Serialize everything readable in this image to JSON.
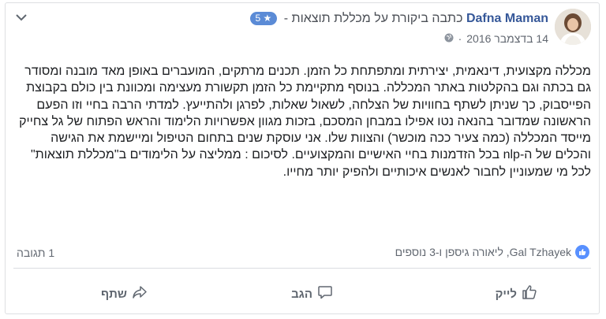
{
  "post": {
    "author": "Dafna Maman",
    "action_text": "כתבה ביקורת על מכללת תוצאות -",
    "rating_badge": "5 ★",
    "date": "14 בדצמבר 2016",
    "body": "מכללה מקצועית, דינאמית, יצירתית ומתפתחת כל הזמן. תכנים מרתקים, המועברים באופן מאד מובנה ומסודר גם בכתה וגם בהקלטות באתר המכללה. בנוסף מתקיימת כל הזמן תקשורת מעצימה ומכוונת בין כולם בקבוצת הפייסבוק, כך שניתן לשתף בחוויות של הצלחה, לשאול שאלות, לפרגן ולהתייעץ. למדתי הרבה בחיי וזו הפעם הראשונה שמדובר בהנאה נטו אפילו במבחן המסכם, בזכות מגוון אפשרויות הלימוד והראש הפתוח של גל צחייק מייסד המכללה (כמה צעיר ככה מוכשר) והצוות שלו. אני עוסקת שנים בתחום הטיפול ומיישמת את הגישה והכלים של ה-nlp בכל הזדמנות בחיי האישיים והמקצועיים. לסיכום : ממליצה על הלימודים ב\"מכללת תוצאות\" לכל מי שמעוניין לחבור לאנשים איכותיים ולהפיק יותר מחייו."
  },
  "reactions": {
    "text": "Gal Tzhayek, ליאורה גיספן ו-3 נוספים",
    "comments": "1 תגובה"
  },
  "actions": {
    "like": "לייק",
    "comment": "הגב",
    "share": "שתף"
  },
  "colors": {
    "author": "#365899",
    "badge": "#5b8bd6",
    "like": "#5890ff"
  }
}
